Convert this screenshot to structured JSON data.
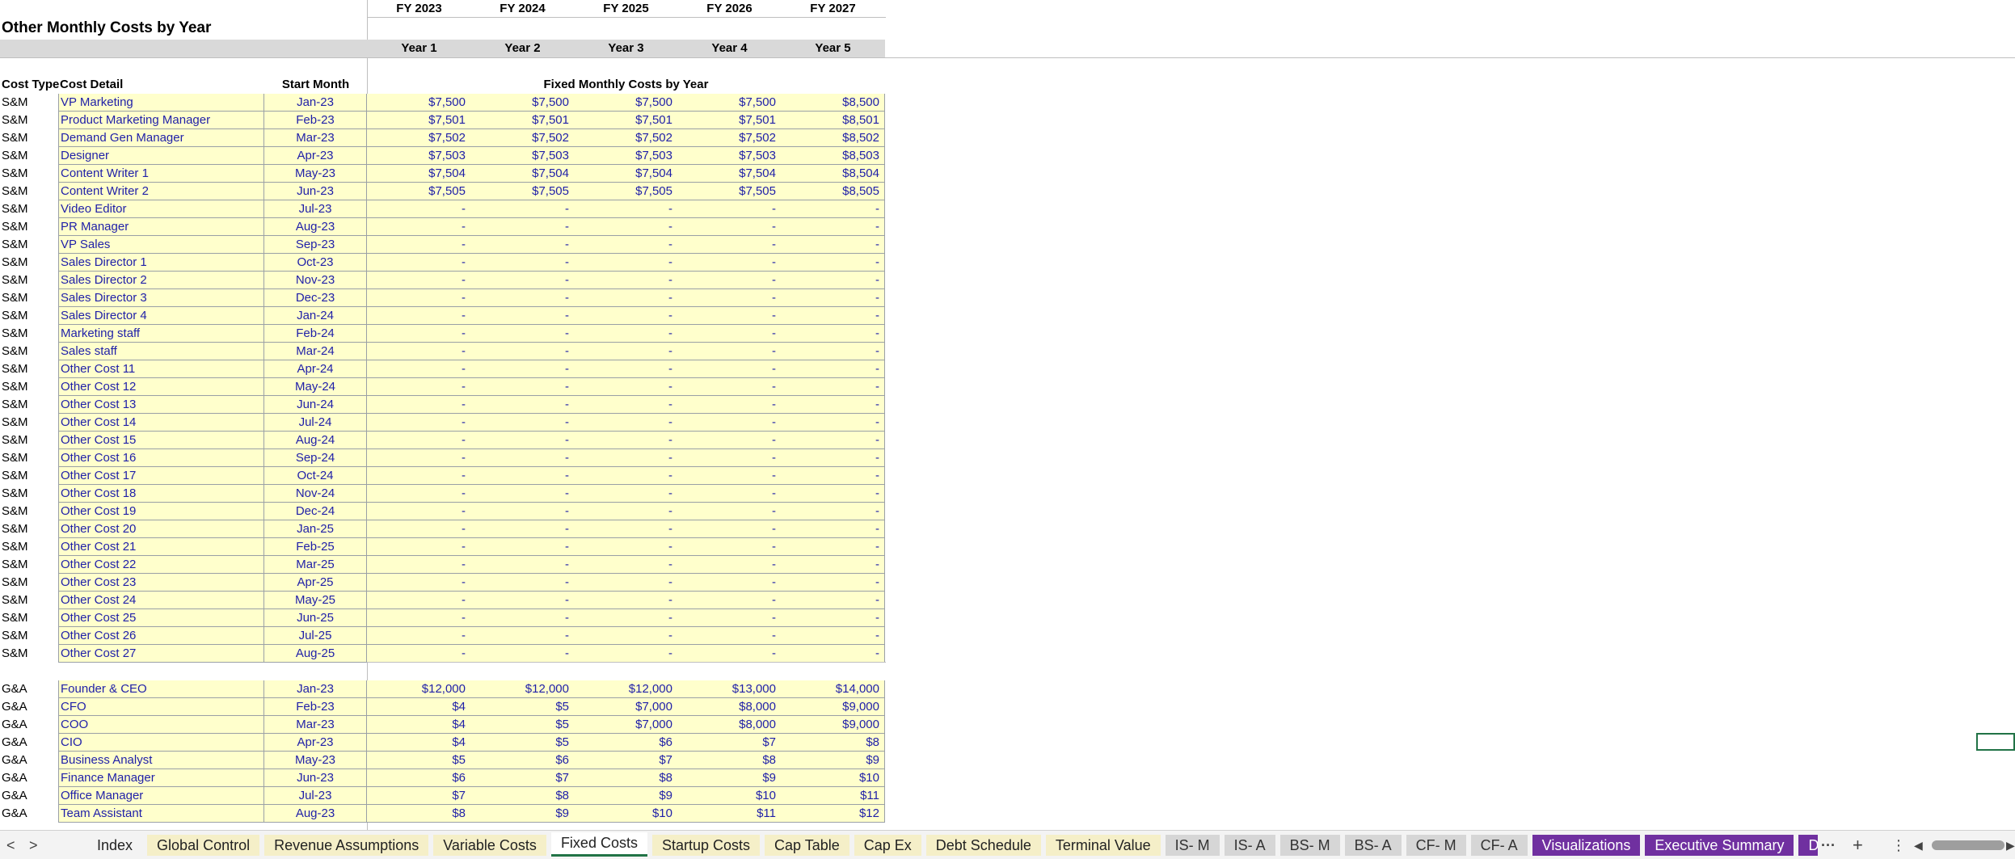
{
  "title": "Other Monthly Costs by Year",
  "fiscal_years": [
    "FY 2023",
    "FY 2024",
    "FY 2025",
    "FY 2026",
    "FY 2027"
  ],
  "years": [
    "Year 1",
    "Year 2",
    "Year 3",
    "Year 4",
    "Year 5"
  ],
  "col_headers": {
    "cost_type": "Cost Type",
    "cost_detail": "Cost Detail",
    "start_month": "Start Month",
    "fixed": "Fixed Monthly Costs by Year"
  },
  "sm_rows": [
    [
      "S&M",
      "VP Marketing",
      "Jan-23",
      "$7,500",
      "$7,500",
      "$7,500",
      "$7,500",
      "$8,500"
    ],
    [
      "S&M",
      "Product Marketing Manager",
      "Feb-23",
      "$7,501",
      "$7,501",
      "$7,501",
      "$7,501",
      "$8,501"
    ],
    [
      "S&M",
      "Demand Gen Manager",
      "Mar-23",
      "$7,502",
      "$7,502",
      "$7,502",
      "$7,502",
      "$8,502"
    ],
    [
      "S&M",
      "Designer",
      "Apr-23",
      "$7,503",
      "$7,503",
      "$7,503",
      "$7,503",
      "$8,503"
    ],
    [
      "S&M",
      "Content Writer 1",
      "May-23",
      "$7,504",
      "$7,504",
      "$7,504",
      "$7,504",
      "$8,504"
    ],
    [
      "S&M",
      "Content Writer 2",
      "Jun-23",
      "$7,505",
      "$7,505",
      "$7,505",
      "$7,505",
      "$8,505"
    ],
    [
      "S&M",
      "Video Editor",
      "Jul-23",
      "-",
      "-",
      "-",
      "-",
      "-"
    ],
    [
      "S&M",
      "PR Manager",
      "Aug-23",
      "-",
      "-",
      "-",
      "-",
      "-"
    ],
    [
      "S&M",
      "VP Sales",
      "Sep-23",
      "-",
      "-",
      "-",
      "-",
      "-"
    ],
    [
      "S&M",
      "Sales Director 1",
      "Oct-23",
      "-",
      "-",
      "-",
      "-",
      "-"
    ],
    [
      "S&M",
      "Sales Director 2",
      "Nov-23",
      "-",
      "-",
      "-",
      "-",
      "-"
    ],
    [
      "S&M",
      "Sales Director 3",
      "Dec-23",
      "-",
      "-",
      "-",
      "-",
      "-"
    ],
    [
      "S&M",
      "Sales Director 4",
      "Jan-24",
      "-",
      "-",
      "-",
      "-",
      "-"
    ],
    [
      "S&M",
      "Marketing staff",
      "Feb-24",
      "-",
      "-",
      "-",
      "-",
      "-"
    ],
    [
      "S&M",
      "Sales staff",
      "Mar-24",
      "-",
      "-",
      "-",
      "-",
      "-"
    ],
    [
      "S&M",
      "Other Cost 11",
      "Apr-24",
      "-",
      "-",
      "-",
      "-",
      "-"
    ],
    [
      "S&M",
      "Other Cost 12",
      "May-24",
      "-",
      "-",
      "-",
      "-",
      "-"
    ],
    [
      "S&M",
      "Other Cost 13",
      "Jun-24",
      "-",
      "-",
      "-",
      "-",
      "-"
    ],
    [
      "S&M",
      "Other Cost 14",
      "Jul-24",
      "-",
      "-",
      "-",
      "-",
      "-"
    ],
    [
      "S&M",
      "Other Cost 15",
      "Aug-24",
      "-",
      "-",
      "-",
      "-",
      "-"
    ],
    [
      "S&M",
      "Other Cost 16",
      "Sep-24",
      "-",
      "-",
      "-",
      "-",
      "-"
    ],
    [
      "S&M",
      "Other Cost 17",
      "Oct-24",
      "-",
      "-",
      "-",
      "-",
      "-"
    ],
    [
      "S&M",
      "Other Cost 18",
      "Nov-24",
      "-",
      "-",
      "-",
      "-",
      "-"
    ],
    [
      "S&M",
      "Other Cost 19",
      "Dec-24",
      "-",
      "-",
      "-",
      "-",
      "-"
    ],
    [
      "S&M",
      "Other Cost 20",
      "Jan-25",
      "-",
      "-",
      "-",
      "-",
      "-"
    ],
    [
      "S&M",
      "Other Cost 21",
      "Feb-25",
      "-",
      "-",
      "-",
      "-",
      "-"
    ],
    [
      "S&M",
      "Other Cost 22",
      "Mar-25",
      "-",
      "-",
      "-",
      "-",
      "-"
    ],
    [
      "S&M",
      "Other Cost 23",
      "Apr-25",
      "-",
      "-",
      "-",
      "-",
      "-"
    ],
    [
      "S&M",
      "Other Cost 24",
      "May-25",
      "-",
      "-",
      "-",
      "-",
      "-"
    ],
    [
      "S&M",
      "Other Cost 25",
      "Jun-25",
      "-",
      "-",
      "-",
      "-",
      "-"
    ],
    [
      "S&M",
      "Other Cost 26",
      "Jul-25",
      "-",
      "-",
      "-",
      "-",
      "-"
    ],
    [
      "S&M",
      "Other Cost 27",
      "Aug-25",
      "-",
      "-",
      "-",
      "-",
      "-"
    ]
  ],
  "ga_rows": [
    [
      "G&A",
      "Founder & CEO",
      "Jan-23",
      "$12,000",
      "$12,000",
      "$12,000",
      "$13,000",
      "$14,000"
    ],
    [
      "G&A",
      "CFO",
      "Feb-23",
      "$4",
      "$5",
      "$7,000",
      "$8,000",
      "$9,000"
    ],
    [
      "G&A",
      "COO",
      "Mar-23",
      "$4",
      "$5",
      "$7,000",
      "$8,000",
      "$9,000"
    ],
    [
      "G&A",
      "CIO",
      "Apr-23",
      "$4",
      "$5",
      "$6",
      "$7",
      "$8"
    ],
    [
      "G&A",
      "Business Analyst",
      "May-23",
      "$5",
      "$6",
      "$7",
      "$8",
      "$9"
    ],
    [
      "G&A",
      "Finance Manager",
      "Jun-23",
      "$6",
      "$7",
      "$8",
      "$9",
      "$10"
    ],
    [
      "G&A",
      "Office Manager",
      "Jul-23",
      "$7",
      "$8",
      "$9",
      "$10",
      "$11"
    ],
    [
      "G&A",
      "Team Assistant",
      "Aug-23",
      "$8",
      "$9",
      "$10",
      "$11",
      "$12"
    ]
  ],
  "tabs": [
    {
      "label": "Index",
      "style": "plain"
    },
    {
      "label": "Global Control",
      "style": "gold"
    },
    {
      "label": "Revenue Assumptions",
      "style": "gold"
    },
    {
      "label": "Variable Costs",
      "style": "gold"
    },
    {
      "label": "Fixed Costs",
      "style": "active"
    },
    {
      "label": "Startup Costs",
      "style": "gold"
    },
    {
      "label": "Cap Table",
      "style": "gold"
    },
    {
      "label": "Cap Ex",
      "style": "gold"
    },
    {
      "label": "Debt Schedule",
      "style": "gold"
    },
    {
      "label": "Terminal Value",
      "style": "gold"
    },
    {
      "label": "IS- M",
      "style": "gray"
    },
    {
      "label": "IS- A",
      "style": "gray"
    },
    {
      "label": "BS- M",
      "style": "gray"
    },
    {
      "label": "BS- A",
      "style": "gray"
    },
    {
      "label": "CF- M",
      "style": "gray"
    },
    {
      "label": "CF- A",
      "style": "gray"
    },
    {
      "label": "Visualizations",
      "style": "purple"
    },
    {
      "label": "Executive Summary",
      "style": "purple"
    },
    {
      "label": "Dist",
      "style": "purple"
    }
  ],
  "tab_controls": {
    "prev": "<",
    "next": ">",
    "more": "···",
    "add": "+",
    "options": "⋮"
  },
  "colors": {
    "input_fill": "#ffffcc",
    "input_text": "#1f1fa8",
    "band": "#d9d9d9",
    "purple_tab": "#7030a0",
    "gold_tab": "#f5efc8"
  }
}
